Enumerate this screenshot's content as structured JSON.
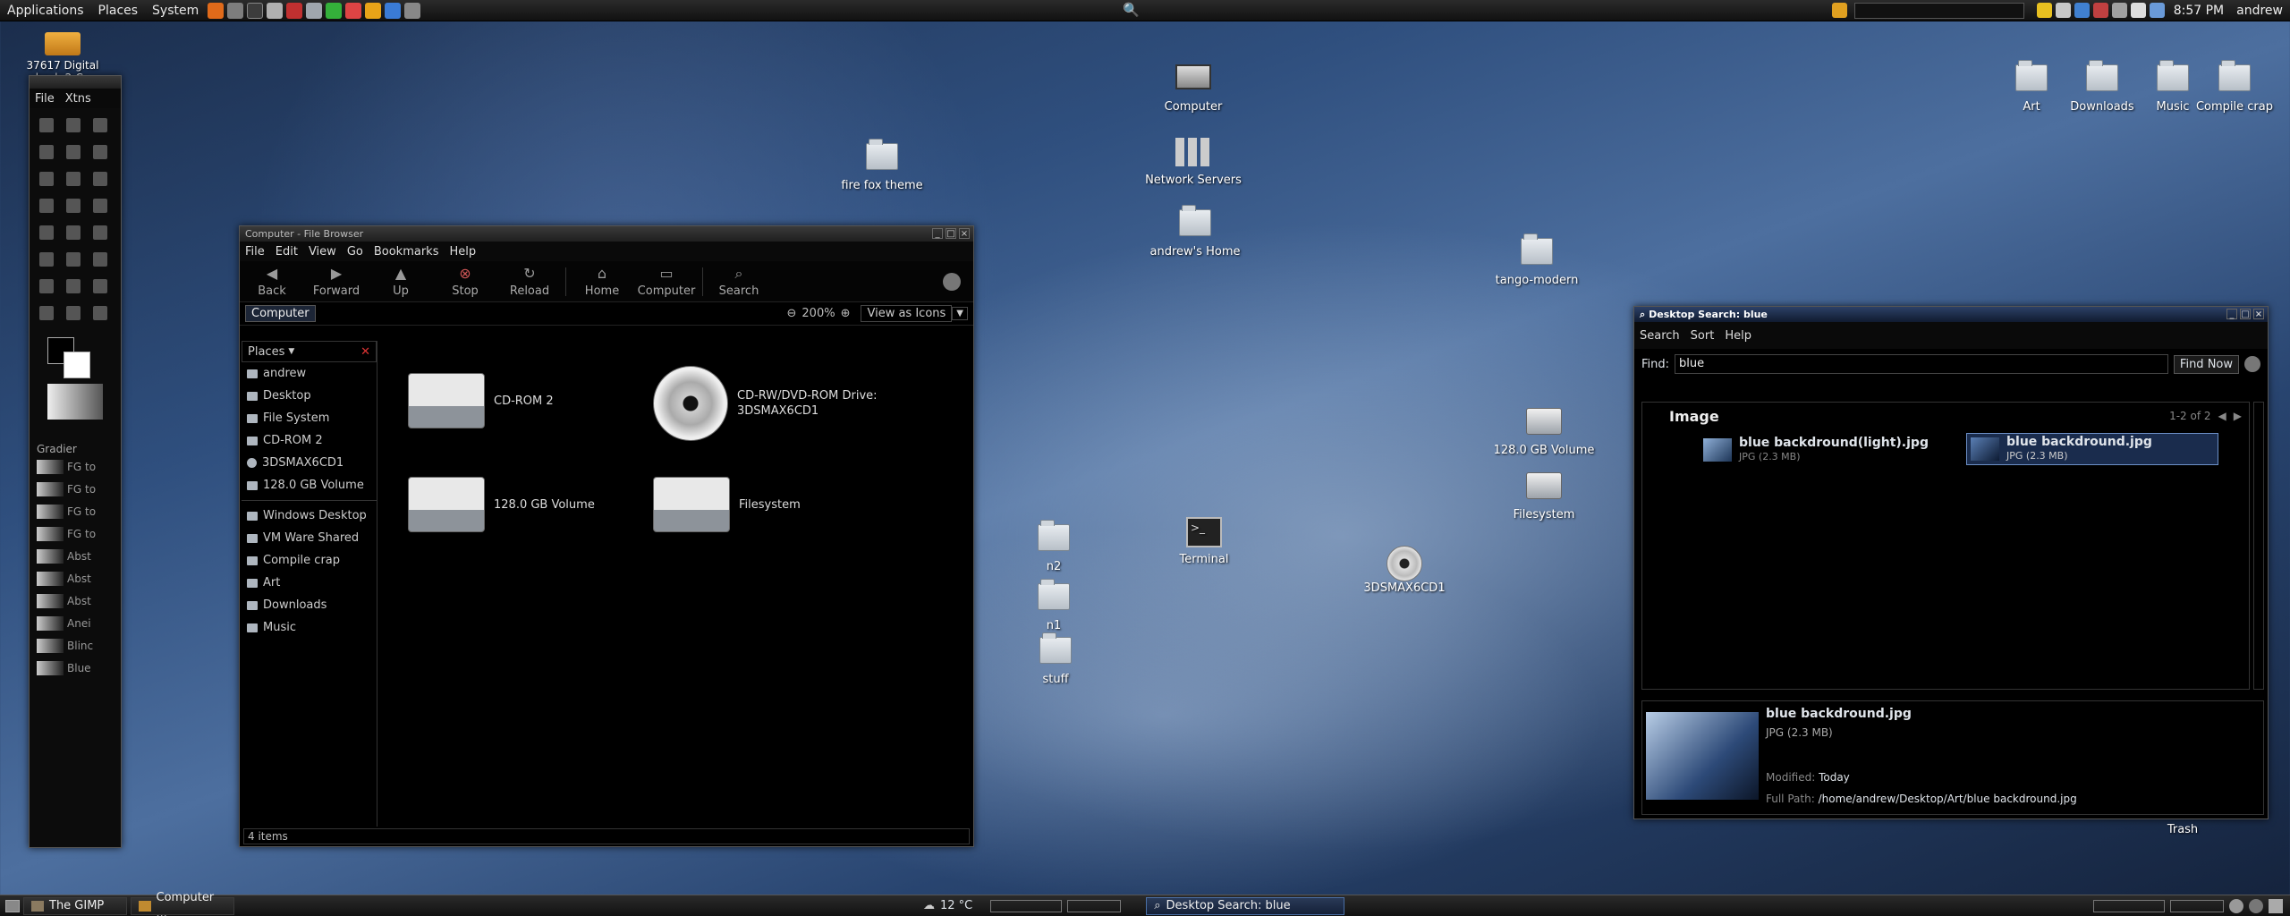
{
  "top_panel": {
    "menus": [
      "Applications",
      "Places",
      "System"
    ],
    "clock": "8:57 PM",
    "user": "andrew"
  },
  "desktop_icons": {
    "top_left_label": "37617 Digital back-2-Co",
    "fire_fox_theme": "fire fox theme",
    "computer": "Computer",
    "network_servers": "Network Servers",
    "andrews_home": "andrew's Home",
    "tango_modern": "tango-modern",
    "art": "Art",
    "downloads": "Downloads",
    "music": "Music",
    "compile_crap": "Compile crap",
    "volume_128": "128.0 GB Volume",
    "filesystem": "Filesystem",
    "terminal": "Terminal",
    "dvd": "3DSMAX6CD1",
    "n2": "n2",
    "n1": "n1",
    "stuff": "stuff",
    "trash": "Trash"
  },
  "gimp": {
    "menus": [
      "File",
      "Xtns"
    ],
    "gradients_label": "Gradier",
    "gradients": [
      "FG to",
      "FG to",
      "FG to",
      "FG to",
      "Abst",
      "Abst",
      "Abst",
      "Anei",
      "Blinc",
      "Blue"
    ]
  },
  "file_browser": {
    "title": "Computer - File Browser",
    "menus": [
      "File",
      "Edit",
      "View",
      "Go",
      "Bookmarks",
      "Help"
    ],
    "toolbar": {
      "back": "Back",
      "forward": "Forward",
      "up": "Up",
      "stop": "Stop",
      "reload": "Reload",
      "home": "Home",
      "computer": "Computer",
      "search": "Search"
    },
    "location": "Computer",
    "zoom": "200%",
    "view_mode": "View as Icons",
    "places_label": "Places",
    "places": [
      "andrew",
      "Desktop",
      "File System",
      "CD-ROM 2",
      "3DSMAX6CD1",
      "128.0 GB Volume"
    ],
    "bookmarks": [
      "Windows Desktop",
      "VM Ware Shared",
      "Compile crap",
      "Art",
      "Downloads",
      "Music"
    ],
    "items": {
      "cdrom2": "CD-ROM 2",
      "dvd_line1": "CD-RW/DVD-ROM Drive:",
      "dvd_line2": "3DSMAX6CD1",
      "volume": "128.0 GB Volume",
      "filesystem": "Filesystem"
    },
    "status": "4 items"
  },
  "desktop_search": {
    "title": "Desktop Search: blue",
    "menus": [
      "Search",
      "Sort",
      "Help"
    ],
    "find_label": "Find:",
    "query": "blue",
    "find_button": "Find Now",
    "category": "Image",
    "result_count": "1-2 of 2",
    "results": [
      {
        "name": "blue backdround(light).jpg",
        "meta": "JPG (2.3 MB)"
      },
      {
        "name": "blue backdround.jpg",
        "meta": "JPG (2.3 MB)"
      }
    ],
    "detail": {
      "name": "blue backdround.jpg",
      "meta": "JPG (2.3 MB)",
      "modified_label": "Modified:",
      "modified": "Today",
      "path_label": "Full Path:",
      "path": "/home/andrew/Desktop/Art/blue backdround.jpg"
    }
  },
  "bottom_panel": {
    "tasks": [
      "The GIMP",
      "Computer ...",
      "Desktop Search: blue"
    ],
    "weather": "12 °C"
  }
}
